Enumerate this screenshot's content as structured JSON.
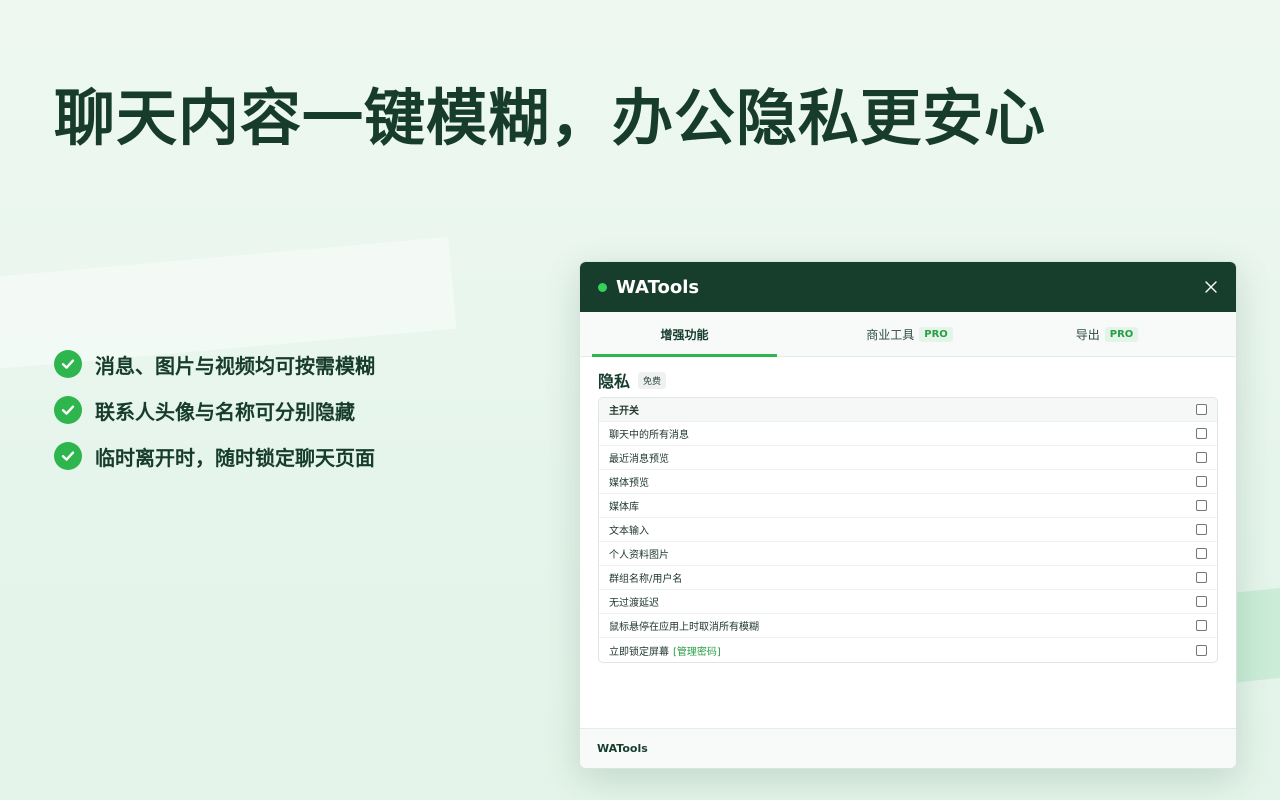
{
  "colors": {
    "brand_dark": "#173d2d",
    "accent_green": "#2eb54d",
    "status_dot": "#36d05d",
    "background": "#eef8f1"
  },
  "headline": "聊天内容一键模糊，办公隐私更安心",
  "features": [
    {
      "icon": "check-circle-icon",
      "text": "消息、图片与视频均可按需模糊"
    },
    {
      "icon": "check-circle-icon",
      "text": "联系人头像与名称可分别隐藏"
    },
    {
      "icon": "check-circle-icon",
      "text": "临时离开时，随时锁定聊天页面"
    }
  ],
  "window": {
    "title": "WATools",
    "close_icon": "close-icon",
    "tabs": [
      {
        "label": "增强功能",
        "badge": "",
        "active": true
      },
      {
        "label": "商业工具",
        "badge": "PRO",
        "active": false
      },
      {
        "label": "导出",
        "badge": "PRO",
        "active": false
      }
    ],
    "section": {
      "title": "隐私",
      "badge": "免费",
      "rows": [
        {
          "label": "主开关",
          "link": "",
          "checked": false
        },
        {
          "label": "聊天中的所有消息",
          "link": "",
          "checked": false
        },
        {
          "label": "最近消息预览",
          "link": "",
          "checked": false
        },
        {
          "label": "媒体预览",
          "link": "",
          "checked": false
        },
        {
          "label": "媒体库",
          "link": "",
          "checked": false
        },
        {
          "label": "文本输入",
          "link": "",
          "checked": false
        },
        {
          "label": "个人资料图片",
          "link": "",
          "checked": false
        },
        {
          "label": "群组名称/用户名",
          "link": "",
          "checked": false
        },
        {
          "label": "无过渡延迟",
          "link": "",
          "checked": false
        },
        {
          "label": "鼠标悬停在应用上时取消所有模糊",
          "link": "",
          "checked": false
        },
        {
          "label": "立即锁定屏幕",
          "link": "[管理密码]",
          "checked": false
        }
      ]
    },
    "footer": "WATools"
  }
}
